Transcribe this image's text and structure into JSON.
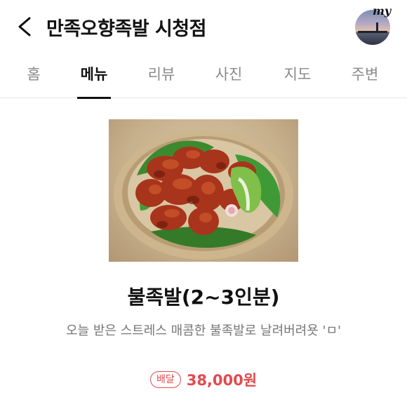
{
  "header": {
    "title": "만족오향족발 시청점",
    "my_label": "my"
  },
  "tabs": [
    {
      "label": "홈",
      "active": false
    },
    {
      "label": "메뉴",
      "active": true
    },
    {
      "label": "리뷰",
      "active": false
    },
    {
      "label": "사진",
      "active": false
    },
    {
      "label": "지도",
      "active": false
    },
    {
      "label": "주변",
      "active": false
    }
  ],
  "menu": {
    "name": "불족발(2~3인분)",
    "description": "오늘 받은 스트레스 매콤한 불족발로 날려버려욧 'ㅁ'",
    "delivery_badge": "배달",
    "price": "38,000원"
  },
  "colors": {
    "accent": "#e24a4f",
    "text": "#111111",
    "inactive_tab": "#8a8a8a",
    "description": "#777777"
  },
  "icons": {
    "back": "chevron-left-icon"
  }
}
